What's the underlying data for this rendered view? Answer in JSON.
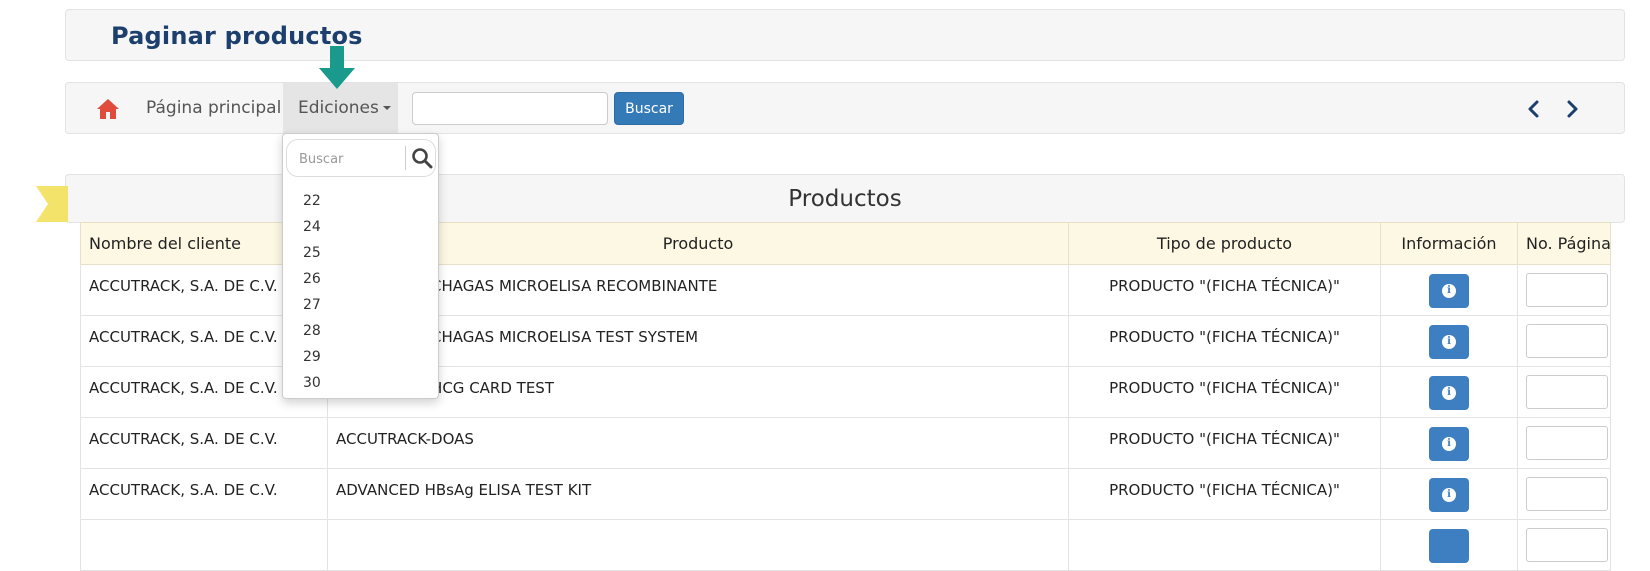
{
  "page": {
    "title": "Paginar productos"
  },
  "navbar": {
    "home_label": "Página principal",
    "editions_label": "Ediciones",
    "search_placeholder": "",
    "search_button": "Buscar"
  },
  "dropdown": {
    "search_placeholder": "Buscar",
    "items": [
      "22",
      "24",
      "25",
      "26",
      "27",
      "28",
      "29",
      "30"
    ]
  },
  "section": {
    "title": "Productos"
  },
  "table": {
    "headers": [
      "Nombre del cliente",
      "Producto",
      "Tipo de producto",
      "Información",
      "No. Página"
    ],
    "rows": [
      {
        "client": "ACCUTRACK, S.A. DE C.V.",
        "product": "ACCUTRACK-CHAGAS MICROELISA RECOMBINANTE",
        "type": "PRODUCTO \"(FICHA TÉCNICA)\""
      },
      {
        "client": "ACCUTRACK, S.A. DE C.V.",
        "product": "ACCUTRACK-CHAGAS MICROELISA TEST SYSTEM",
        "type": "PRODUCTO \"(FICHA TÉCNICA)\""
      },
      {
        "client": "ACCUTRACK, S.A. DE C.V.",
        "product": "ACCUTRACK-HCG CARD TEST",
        "type": "PRODUCTO \"(FICHA TÉCNICA)\""
      },
      {
        "client": "ACCUTRACK, S.A. DE C.V.",
        "product": "ACCUTRACK-DOAS",
        "type": "PRODUCTO \"(FICHA TÉCNICA)\""
      },
      {
        "client": "ACCUTRACK, S.A. DE C.V.",
        "product": "ADVANCED HBsAg ELISA TEST KIT",
        "type": "PRODUCTO \"(FICHA TÉCNICA)\""
      }
    ]
  },
  "colors": {
    "title": "#1d3f6e",
    "primary_button": "#337ab7",
    "home_icon": "#e04b3c",
    "arrow_indicator": "#1a9a8c",
    "ribbon": "#f4e36a",
    "table_header_bg": "#fcf8e3"
  },
  "icons": {
    "home": "home-icon",
    "search": "search-icon",
    "prev": "chevron-left-icon",
    "next": "chevron-right-icon",
    "info": "info-icon"
  }
}
